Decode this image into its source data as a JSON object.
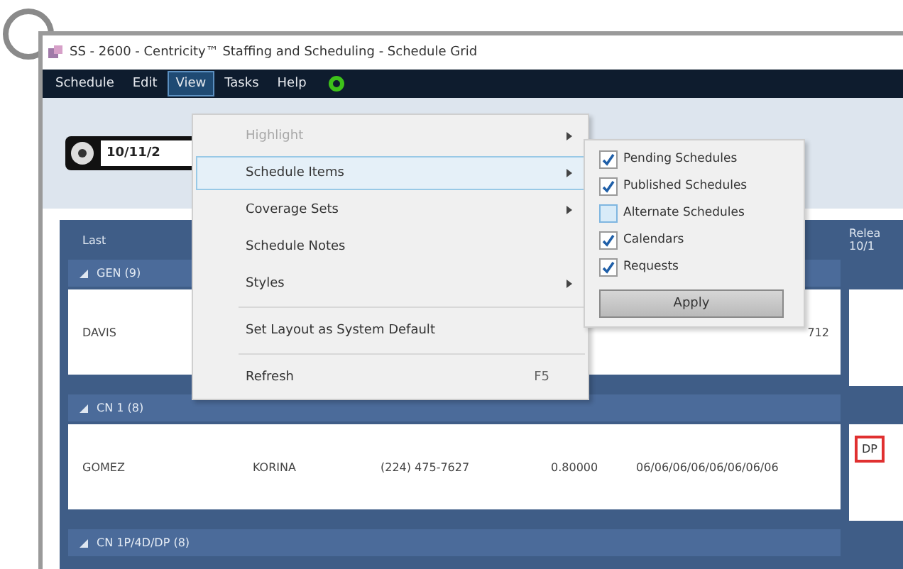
{
  "window": {
    "title": "SS - 2600 - Centricity™ Staffing and Scheduling - Schedule Grid"
  },
  "menu_bar": [
    {
      "label": "Schedule",
      "selected": false
    },
    {
      "label": "Edit",
      "selected": false
    },
    {
      "label": "View",
      "selected": true
    },
    {
      "label": "Tasks",
      "selected": false
    },
    {
      "label": "Help",
      "selected": false
    }
  ],
  "toolbar": {
    "date": "10/11/2"
  },
  "view_menu": [
    {
      "kind": "item",
      "label": "Highlight",
      "disabled": true,
      "submenu": true,
      "selected": false
    },
    {
      "kind": "item",
      "label": "Schedule Items",
      "disabled": false,
      "submenu": true,
      "selected": true
    },
    {
      "kind": "item",
      "label": "Coverage Sets",
      "disabled": false,
      "submenu": true,
      "selected": false
    },
    {
      "kind": "item",
      "label": "Schedule Notes",
      "disabled": false,
      "submenu": false,
      "selected": false
    },
    {
      "kind": "item",
      "label": "Styles",
      "disabled": false,
      "submenu": true,
      "selected": false
    },
    {
      "kind": "separator"
    },
    {
      "kind": "item",
      "label": "Set Layout as System Default",
      "disabled": false,
      "submenu": false,
      "selected": false
    },
    {
      "kind": "separator"
    },
    {
      "kind": "item",
      "label": "Refresh",
      "shortcut": "F5",
      "disabled": false,
      "submenu": false,
      "selected": false
    }
  ],
  "schedule_items_menu": {
    "options": [
      {
        "label": "Pending Schedules",
        "checked": true,
        "selected": false
      },
      {
        "label": "Published Schedules",
        "checked": true,
        "selected": false
      },
      {
        "label": "Alternate Schedules",
        "checked": false,
        "selected": true
      },
      {
        "label": "Calendars",
        "checked": true,
        "selected": false
      },
      {
        "label": "Requests",
        "checked": true,
        "selected": false
      }
    ],
    "button": "Apply"
  },
  "grid": {
    "columns": [
      {
        "label": "Last"
      }
    ],
    "side_column": {
      "line_1": "Relea",
      "line_2": "10/1"
    },
    "groups": [
      {
        "label": "GEN (9)",
        "expanded": true,
        "rows": [
          {
            "last": "DAVIS",
            "shifts": "712"
          }
        ]
      },
      {
        "label": "CN 1 (8)",
        "expanded": true,
        "rows": [
          {
            "last": "GOMEZ",
            "first": "KORINA",
            "phone": "(224) 475-7627",
            "fte": "0.80000",
            "shifts": "06/06/06/06/06/06/06/06",
            "side": "DP"
          }
        ]
      },
      {
        "label": "CN 1P/4D/DP (8)",
        "expanded": true
      }
    ]
  }
}
